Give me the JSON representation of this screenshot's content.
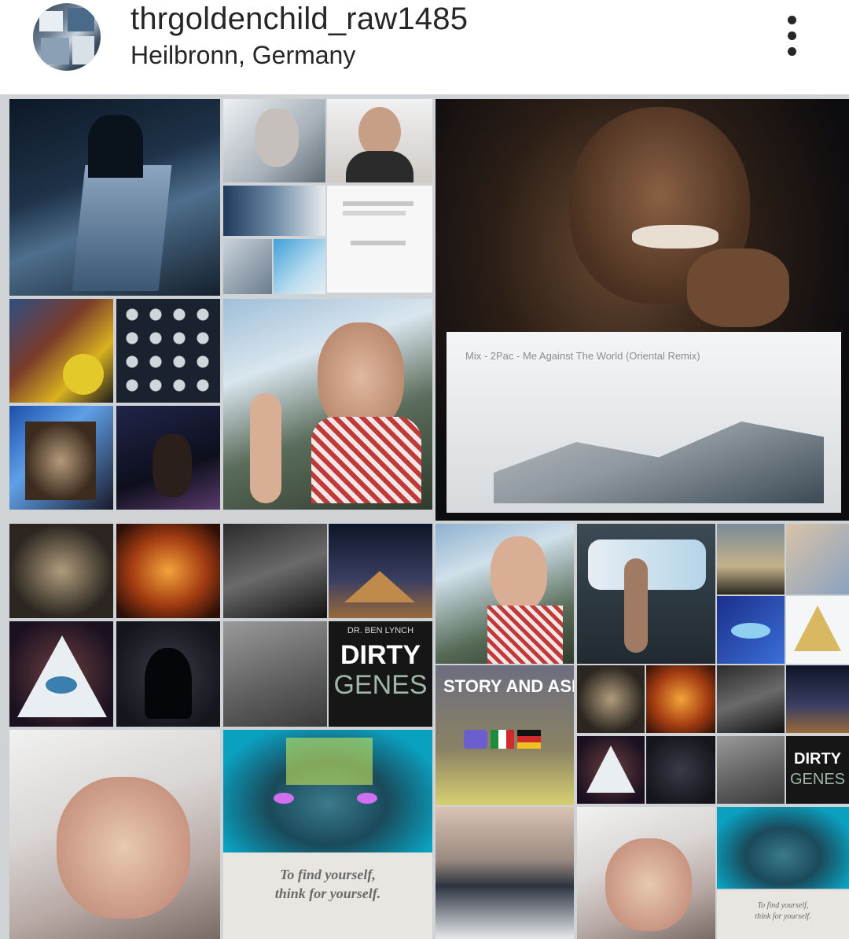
{
  "post_header": {
    "username": "thrgoldenchild_raw1485",
    "location": "Heilbronn, Germany",
    "more_icon": "more-vertical-icon"
  },
  "collage": {
    "tupac_caption": "Mix - 2Pac - Me Against The World (Oriental Remix)",
    "book_author": "DR. BEN LYNCH",
    "book_title_line1": "DIRTY",
    "book_title_line2": "GENES",
    "story_label": "STORY AND ASK",
    "quote_line1": "To find yourself,",
    "quote_line2": "think for yourself.",
    "small_book_title_line1": "DIRTY",
    "small_book_title_line2": "GENES",
    "small_quote_line1": "To find yourself,",
    "small_quote_line2": "think for yourself."
  }
}
